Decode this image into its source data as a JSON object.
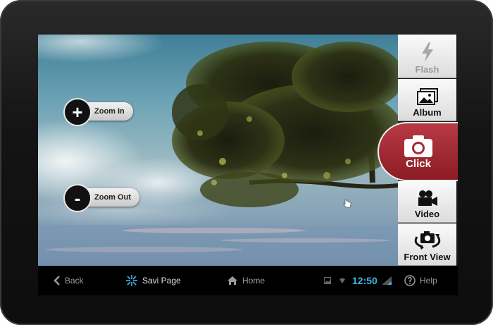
{
  "viewfinder": {
    "zoom_in_label": "Zoom In",
    "zoom_out_label": "Zoom Out",
    "zoom_in_symbol": "+",
    "zoom_out_symbol": "-"
  },
  "side_menu": {
    "flash_label": "Flash",
    "flash_enabled": false,
    "album_label": "Album",
    "click_label": "Click",
    "video_label": "Video",
    "front_view_label": "Front View"
  },
  "nav": {
    "back_label": "Back",
    "savi_page_label": "Savi Page",
    "home_label": "Home",
    "time": "12:50",
    "help_label": "Help"
  },
  "colors": {
    "click_accent": "#a52a33",
    "clock": "#3fb6e6"
  },
  "icons": [
    "flash-icon",
    "album-icon",
    "camera-icon",
    "video-camera-icon",
    "switch-camera-icon",
    "back-chevron-icon",
    "savi-logo-icon",
    "home-icon",
    "image-status-icon",
    "wifi-icon",
    "battery-icon",
    "help-icon"
  ]
}
